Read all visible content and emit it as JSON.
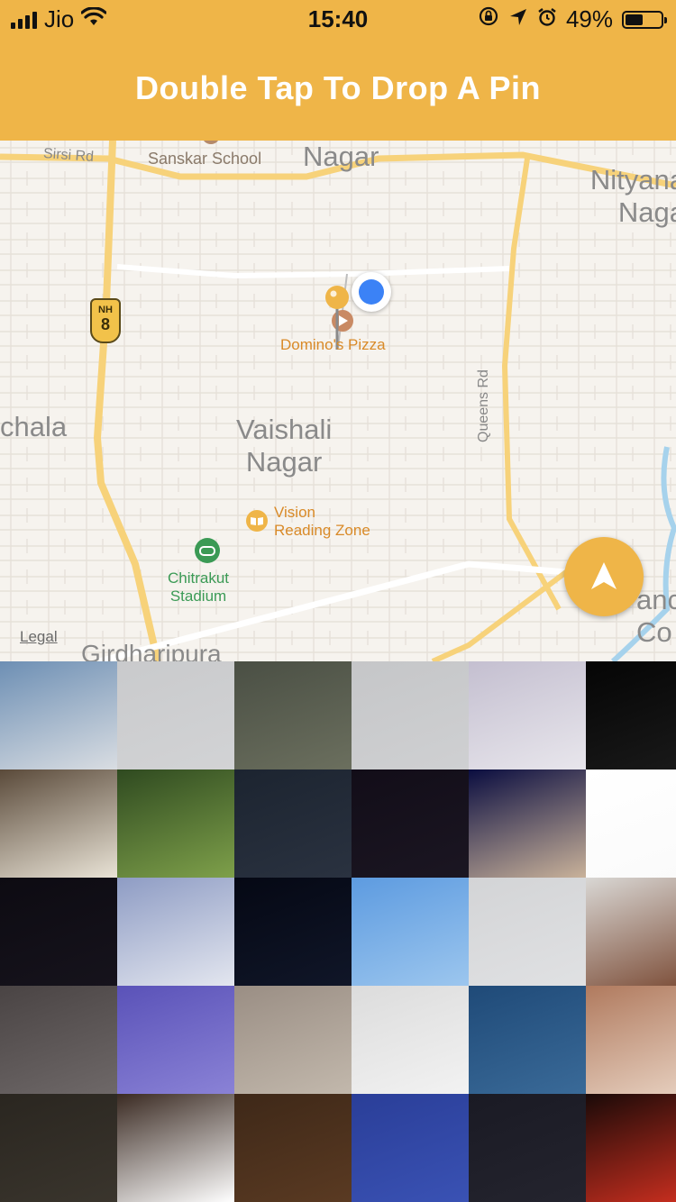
{
  "status_bar": {
    "carrier": "Jio",
    "time": "15:40",
    "battery_percent": "49%",
    "battery_level": 0.49,
    "icons": [
      "signal-icon",
      "wifi-icon",
      "orientation-lock-icon",
      "location-arrow-icon",
      "alarm-icon",
      "battery-icon"
    ]
  },
  "title": "Double Tap To Drop A Pin",
  "map": {
    "areas": {
      "nagar_top": "Nagar",
      "nityanand": "Nityana\nNaga",
      "chala": "chala",
      "vaishali": "Vaishali\nNagar",
      "girdharipura": "Girdharipura",
      "anc": "anc\nCo"
    },
    "roads": {
      "sirsi": "Sirsi Rd",
      "queens": "Queens Rd",
      "nh_top": "NH",
      "nh_num": "8"
    },
    "pois": {
      "sanskar": "Sanskar School",
      "dominos": "Domino's Pizza",
      "vision": "Vision\nReading Zone",
      "chitrakut": "Chitrakut\nStadium"
    },
    "legal": "Legal",
    "colors": {
      "accent": "#efb548",
      "user_location": "#3b82f6",
      "poi_orange": "#d98a28",
      "poi_green": "#3b9a55"
    }
  },
  "photos": {
    "tiles": [
      {
        "name": "photo-building-sky",
        "colors": [
          "#6d8fb4",
          "#d9dde2"
        ]
      },
      {
        "name": "photo-grey-wall",
        "colors": [
          "#c9cacc",
          "#d2d3d5"
        ]
      },
      {
        "name": "photo-dark-green",
        "colors": [
          "#4a4f44",
          "#6b6f5e"
        ]
      },
      {
        "name": "photo-light-grey",
        "colors": [
          "#c5c6c8",
          "#cfd0d2"
        ]
      },
      {
        "name": "photo-fabric",
        "colors": [
          "#c4bfd0",
          "#e8e6ec"
        ]
      },
      {
        "name": "photo-night-tree",
        "colors": [
          "#050505",
          "#1a1a1a"
        ]
      },
      {
        "name": "photo-mesh",
        "colors": [
          "#5a4a3a",
          "#e9e3d6"
        ]
      },
      {
        "name": "photo-leaf",
        "colors": [
          "#2f4a20",
          "#7ea04a"
        ]
      },
      {
        "name": "photo-dark-navy",
        "colors": [
          "#1c2430",
          "#2a3240"
        ]
      },
      {
        "name": "photo-dark-purple",
        "colors": [
          "#120d18",
          "#1b1622"
        ]
      },
      {
        "name": "photo-blue-blur",
        "colors": [
          "#0a0d40",
          "#c9b29a"
        ]
      },
      {
        "name": "photo-white",
        "colors": [
          "#ffffff",
          "#fafafa"
        ]
      },
      {
        "name": "photo-black",
        "colors": [
          "#0d0b12",
          "#16131c"
        ]
      },
      {
        "name": "photo-clouds",
        "colors": [
          "#8e9cc4",
          "#e3e6ef"
        ]
      },
      {
        "name": "photo-night-sky",
        "colors": [
          "#050814",
          "#101628"
        ]
      },
      {
        "name": "photo-blue-sky",
        "colors": [
          "#5d9be0",
          "#9cc6ee"
        ]
      },
      {
        "name": "photo-pale-sky",
        "colors": [
          "#d3d4d6",
          "#e0e1e3"
        ]
      },
      {
        "name": "photo-balcony",
        "colors": [
          "#d9d7d4",
          "#7a4a34"
        ]
      },
      {
        "name": "photo-ceiling",
        "colors": [
          "#4a4444",
          "#6e6868"
        ]
      },
      {
        "name": "photo-violet",
        "colors": [
          "#5a52b8",
          "#8a82d6"
        ]
      },
      {
        "name": "photo-marble",
        "colors": [
          "#9a8e84",
          "#c2b8ac"
        ]
      },
      {
        "name": "photo-light-wall",
        "colors": [
          "#dcdcdc",
          "#f2f2f2"
        ]
      },
      {
        "name": "photo-blue-wires",
        "colors": [
          "#1f4a78",
          "#3a6a98"
        ]
      },
      {
        "name": "photo-carved-ceiling",
        "colors": [
          "#b07a5e",
          "#e8d2c2"
        ]
      },
      {
        "name": "photo-dark-brown",
        "colors": [
          "#2a2620",
          "#3a352d"
        ]
      },
      {
        "name": "photo-carving",
        "colors": [
          "#3a2a22",
          "#ffffff"
        ]
      },
      {
        "name": "photo-brown",
        "colors": [
          "#3e2818",
          "#5a3a22"
        ]
      },
      {
        "name": "photo-deep-blue",
        "colors": [
          "#2a3e98",
          "#3a52b4"
        ]
      },
      {
        "name": "photo-dark-slate",
        "colors": [
          "#1a1a24",
          "#24242e"
        ]
      },
      {
        "name": "photo-red-lights",
        "colors": [
          "#1a0a08",
          "#d03020"
        ]
      }
    ]
  }
}
